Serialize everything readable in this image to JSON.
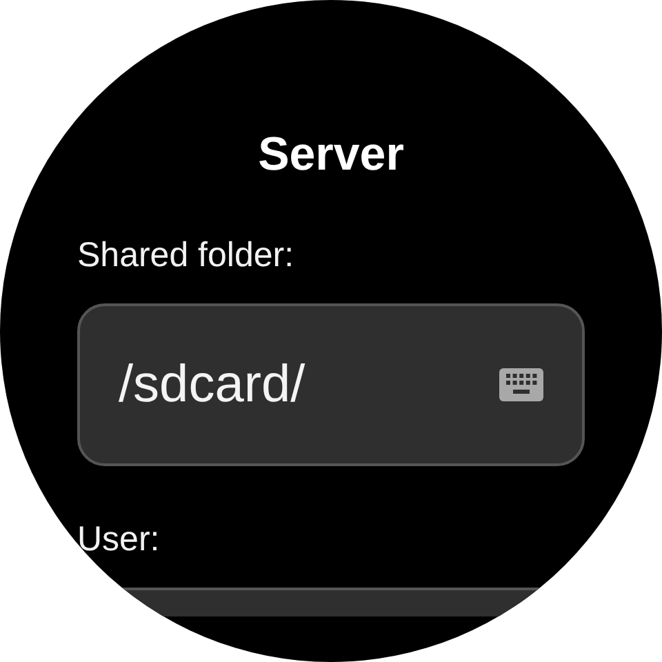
{
  "title": "Server",
  "fields": [
    {
      "label": "Shared folder:",
      "value": "/sdcard/",
      "keyboard": true
    },
    {
      "label": "User:"
    }
  ]
}
